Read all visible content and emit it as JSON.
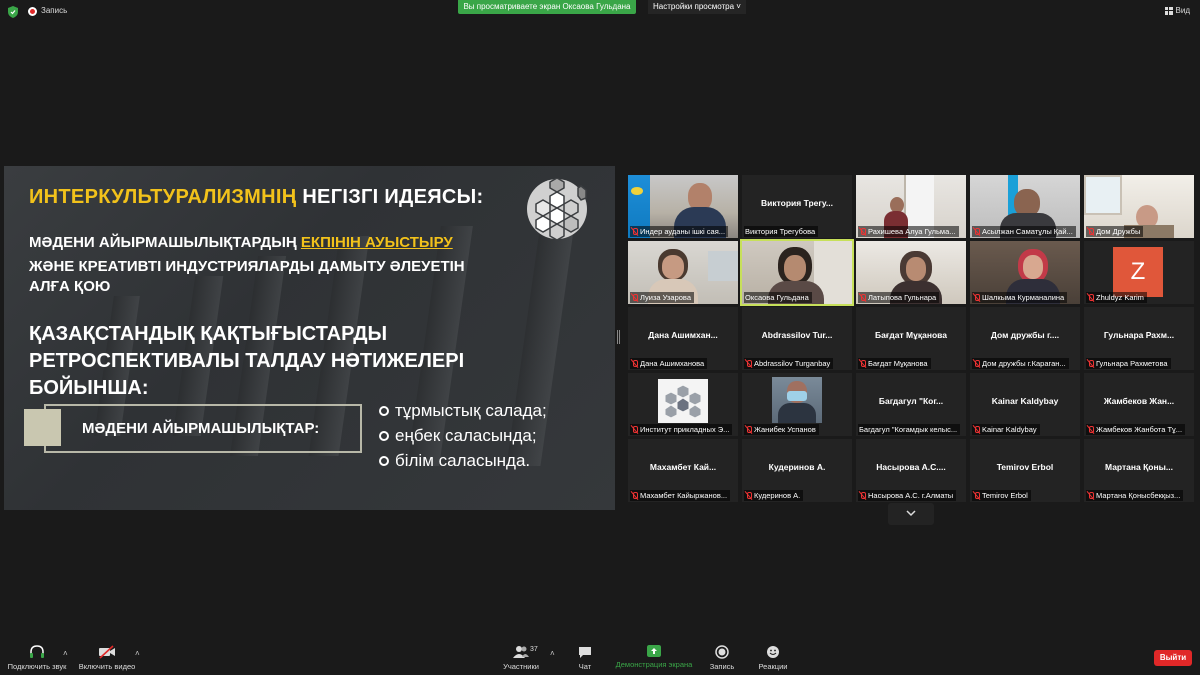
{
  "topbar": {
    "recording_label": "Запись",
    "share_banner": "Вы просматриваете экран Оксаова Гульдана",
    "view_options": "Настройки просмотра ˅",
    "view_toggle": "Вид"
  },
  "slide": {
    "title_yellow": "ИНТЕРКУЛЬТУРАЛИЗМНІҢ ",
    "title_white": "НЕГІЗГІ ИДЕЯСЫ:",
    "line1_white": "МӘДЕНИ АЙЫРМАШЫЛЫҚТАРДЫҢ ",
    "line1_yellow": "ЕКПІНІН АУЫСТЫРУ",
    "line2": "ЖӘНЕ КРЕАТИВТІ ИНДУСТРИЯЛАРДЫ ДАМЫТУ ӘЛЕУЕТІН",
    "line3": "АЛҒА ҚОЮ",
    "heading2_l1": "ҚАЗАҚСТАНДЫҚ ҚАҚТЫҒЫСТАРДЫ",
    "heading2_l2": "РЕТРОСПЕКТИВАЛЫ ТАЛДАУ НӘТИЖЕЛЕРІ",
    "heading2_l3": "БОЙЫНША:",
    "box_label": "МӘДЕНИ АЙЫРМАШЫЛЫҚТАР:",
    "bullets": [
      "тұрмыстық салада;",
      "еңбек саласында;",
      "білім саласында."
    ]
  },
  "tiles": [
    {
      "name": "",
      "label": "Индер ауданы ішкі сая..."
    },
    {
      "name": "Виктория  Трегу...",
      "label": "Виктория Трегубова"
    },
    {
      "name": "",
      "label": "Рахишева Алуа Гульма..."
    },
    {
      "name": "",
      "label": "Асылжан Саматұлы Қай..."
    },
    {
      "name": "",
      "label": "Дом Дружбы"
    },
    {
      "name": "",
      "label": "Луиза Узарова"
    },
    {
      "name": "",
      "label": "Оксаова Гульдана"
    },
    {
      "name": "",
      "label": "Латыпова Гульнара"
    },
    {
      "name": "",
      "label": "Шалкыма Курманалина"
    },
    {
      "name": "Z",
      "label": "Zhuldyz Karim"
    },
    {
      "name": "Дана  Ашимхан...",
      "label": "Дана Ашимханова"
    },
    {
      "name": "Abdrassilov  Tur...",
      "label": "Abdrassilov Turganbay"
    },
    {
      "name": "Бағдат Мұқанова",
      "label": "Бағдат Мұқанова"
    },
    {
      "name": "Дом дружбы г....",
      "label": "Дом дружбы г.Караган..."
    },
    {
      "name": "Гульнара  Рахм...",
      "label": "Гульнара Рахметова"
    },
    {
      "name": "",
      "label": "Институт прикладных Э..."
    },
    {
      "name": "",
      "label": "Жанибек Успанов"
    },
    {
      "name": "Багдагул  \"Ког...",
      "label": "Багдагул \"Когамдык келыс..."
    },
    {
      "name": "Kainar Kaldybay",
      "label": "Kainar Kaldybay"
    },
    {
      "name": "Жамбеков  Жан...",
      "label": "Жамбеков Жанбота Тұ..."
    },
    {
      "name": "Махамбет  Кай...",
      "label": "Махамбет Кайыржанов..."
    },
    {
      "name": "Кудеринов А.",
      "label": "Кудеринов А."
    },
    {
      "name": "Насырова  А.С....",
      "label": "Насырова А.С. г.Алматы"
    },
    {
      "name": "Temirov Erbol",
      "label": "Temirov Erbol"
    },
    {
      "name": "Мартана  Қоны...",
      "label": "Мартана Қонысбекқыз..."
    }
  ],
  "toolbar": {
    "audio": "Подключить звук",
    "video": "Включить видео",
    "participants": "Участники",
    "participants_count": "37",
    "chat": "Чат",
    "share": "Демонстрация экрана",
    "record": "Запись",
    "reactions": "Реакции",
    "leave": "Выйти"
  },
  "colors": {
    "share_green": "#3aa648",
    "accent_yellow": "#f2c21b",
    "leave_red": "#e02828",
    "active_speaker": "#c7e05a"
  }
}
